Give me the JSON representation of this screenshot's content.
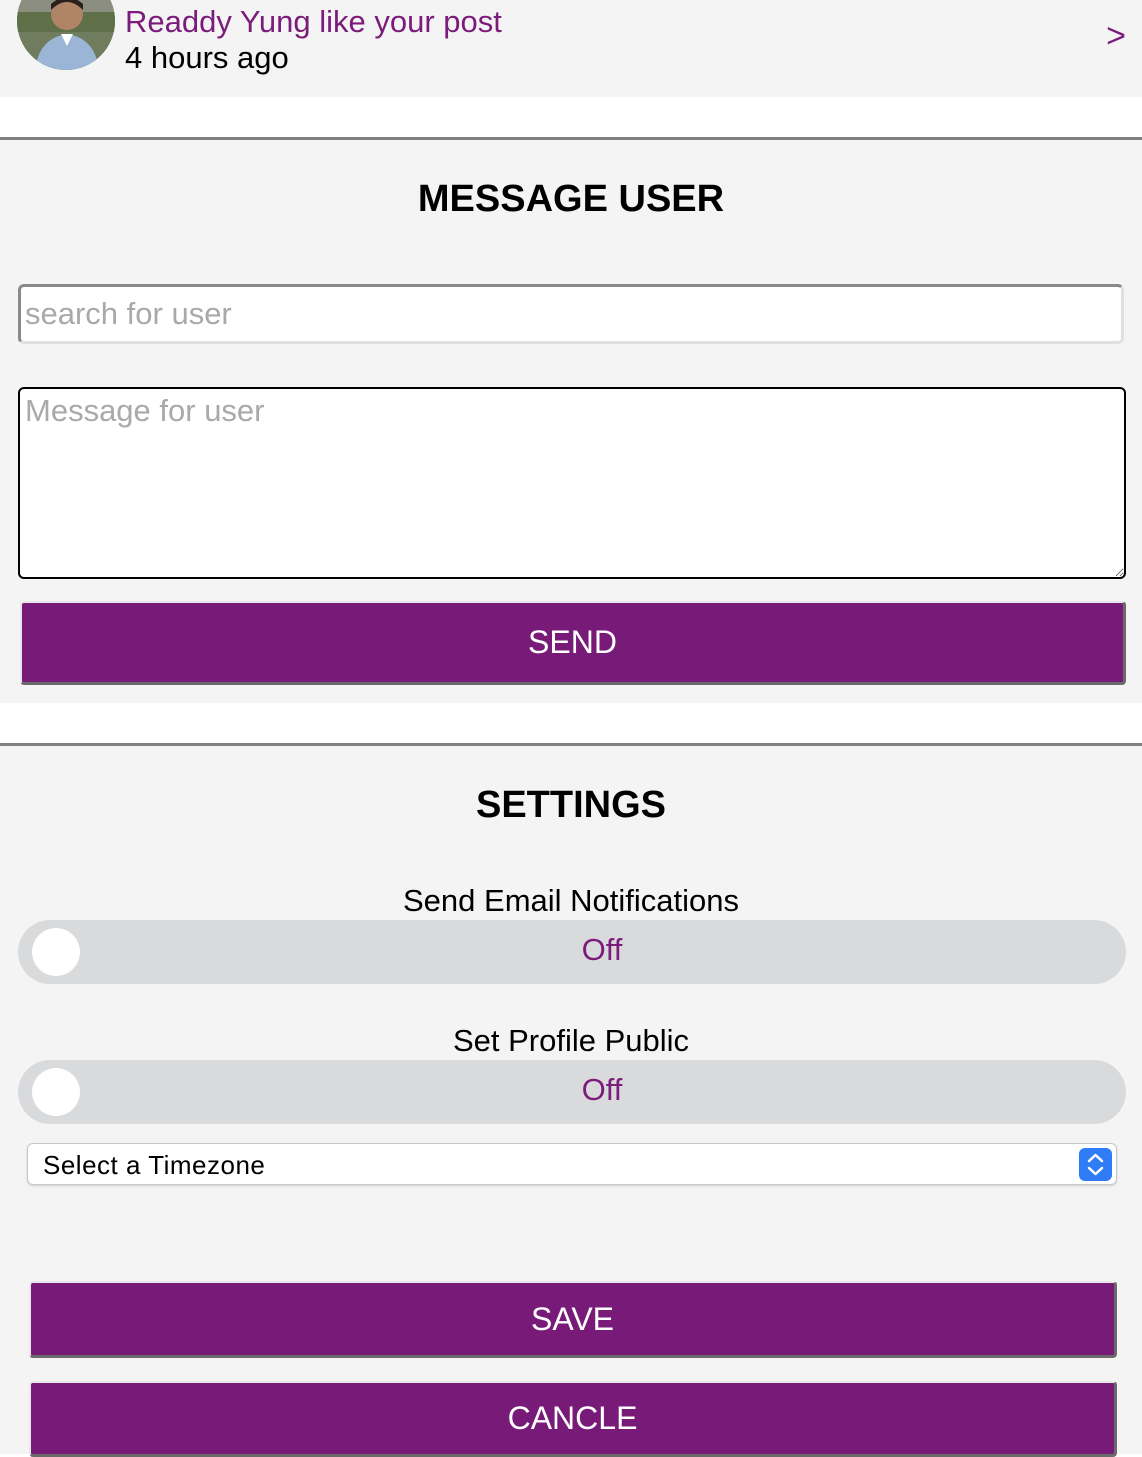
{
  "notification": {
    "text": "Readdy Yung like your post",
    "time": "4 hours ago",
    "chevron": ">"
  },
  "message_user": {
    "title": "MESSAGE USER",
    "search_placeholder": "search for user",
    "message_placeholder": "Message for user",
    "send_label": "SEND"
  },
  "settings": {
    "title": "SETTINGS",
    "email_notifications": {
      "label": "Send Email Notifications",
      "state": "Off"
    },
    "profile_public": {
      "label": "Set Profile Public",
      "state": "Off"
    },
    "timezone": {
      "selected": "Select a Timezone"
    },
    "save_label": "SAVE",
    "cancel_label": "CANCLE"
  },
  "colors": {
    "accent": "#781b78",
    "panel_bg": "#f4f4f4",
    "toggle_bg": "#d9dadb",
    "select_arrow": "#2f7cf6"
  },
  "icons": {
    "avatar": "user-photo",
    "chevron": "chevron-right-icon",
    "select": "select-arrows-icon"
  }
}
